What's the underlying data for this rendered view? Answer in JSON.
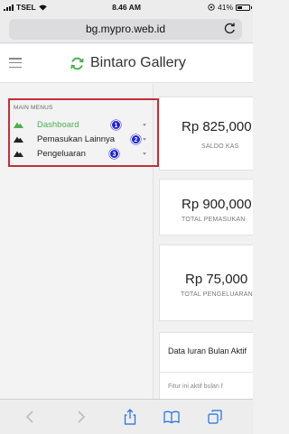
{
  "status_bar": {
    "carrier": "TSEL",
    "time": "8.46 AM",
    "battery": "41%"
  },
  "browser": {
    "url": "bg.mypro.web.id"
  },
  "app": {
    "title": "Bintaro Gallery"
  },
  "sidebar": {
    "heading": "MAIN MENUS",
    "items": [
      {
        "label": "Dashboard",
        "badge": "1",
        "active": true
      },
      {
        "label": "Pemasukan Lainnya",
        "badge": "2",
        "active": false
      },
      {
        "label": "Pengeluaran",
        "badge": "3",
        "active": false
      }
    ]
  },
  "cards": [
    {
      "value": "Rp 825,000",
      "label": "SALDO KAS"
    },
    {
      "value": "Rp 900,000",
      "label": "TOTAL PEMASUKAN"
    },
    {
      "value": "Rp 75,000",
      "label": "TOTAL PENGELUARAN"
    }
  ],
  "iuran_panel": {
    "title": "Data Iuran Bulan Aktif",
    "note": "Fitur ini aktif bulan f"
  },
  "colors": {
    "accent_green": "#4caf50",
    "badge_blue": "#1c22d8",
    "highlight_red": "#c0303a"
  },
  "icons": {
    "menu_item": "mountain-icon",
    "brand": "refresh-circle-icon"
  }
}
